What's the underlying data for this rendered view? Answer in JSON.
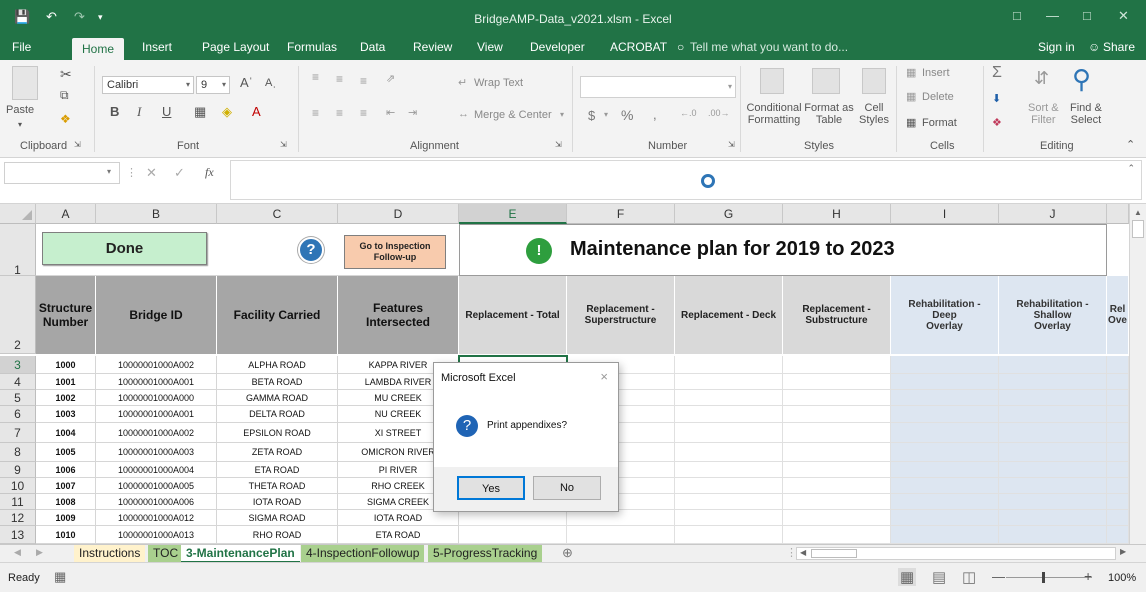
{
  "window": {
    "title": "BridgeAMP-Data_v2021.xlsm - Excel"
  },
  "tabs": [
    {
      "label": "File"
    },
    {
      "label": "Home"
    },
    {
      "label": "Insert"
    },
    {
      "label": "Page Layout"
    },
    {
      "label": "Formulas"
    },
    {
      "label": "Data"
    },
    {
      "label": "Review"
    },
    {
      "label": "View"
    },
    {
      "label": "Developer"
    },
    {
      "label": "ACROBAT"
    }
  ],
  "tell_me": "Tell me what you want to do...",
  "sign_in": "Sign in",
  "share": "Share",
  "ribbon": {
    "paste": "Paste",
    "font_name": "Calibri",
    "font_size": "9",
    "wrap_text": "Wrap Text",
    "merge_center": "Merge & Center",
    "number_format": "",
    "conditional": [
      "Conditional",
      "Formatting"
    ],
    "format_as": [
      "Format as",
      "Table"
    ],
    "cell_styles": [
      "Cell",
      "Styles"
    ],
    "insert": "Insert",
    "delete": "Delete",
    "format": "Format",
    "sort_filter": [
      "Sort &",
      "Filter"
    ],
    "find_select": [
      "Find &",
      "Select"
    ],
    "groups": {
      "clipboard": "Clipboard",
      "font": "Font",
      "alignment": "Alignment",
      "number": "Number",
      "styles": "Styles",
      "cells": "Cells",
      "editing": "Editing"
    }
  },
  "formula_bar": {
    "name_box": "",
    "fx": "fx",
    "content": ""
  },
  "columns": [
    "A",
    "B",
    "C",
    "D",
    "E",
    "F",
    "G",
    "H",
    "I",
    "J"
  ],
  "row_numbers": [
    "1",
    "2",
    "3",
    "4",
    "5",
    "6",
    "7",
    "8",
    "9",
    "10",
    "11",
    "12",
    "13"
  ],
  "buttons": {
    "done": "Done",
    "help": "?",
    "goto": [
      "Go to Inspection",
      "Follow-up"
    ]
  },
  "heading": {
    "icon": "!",
    "text": "Maintenance plan for 2019 to 2023"
  },
  "headers": {
    "a": [
      "Structure",
      "Number"
    ],
    "b": "Bridge ID",
    "c": "Facility Carried",
    "d": "Features Intersected",
    "e": "Replacement - Total",
    "f": [
      "Replacement -",
      "Superstructure"
    ],
    "g": "Replacement - Deck",
    "h": [
      "Replacement -",
      "Substructure"
    ],
    "i": [
      "Rehabilitation - Deep",
      "Overlay"
    ],
    "j": [
      "Rehabilitation - Shallow",
      "Overlay"
    ],
    "k": [
      "Rel",
      "Ove"
    ]
  },
  "rows": [
    {
      "a": "1000",
      "b": "10000001000A002",
      "c": "ALPHA ROAD",
      "d": "KAPPA RIVER"
    },
    {
      "a": "1001",
      "b": "10000001000A001",
      "c": "BETA ROAD",
      "d": "LAMBDA RIVER"
    },
    {
      "a": "1002",
      "b": "10000001000A000",
      "c": "GAMMA ROAD",
      "d": "MU CREEK"
    },
    {
      "a": "1003",
      "b": "10000001000A001",
      "c": "DELTA ROAD",
      "d": "NU CREEK"
    },
    {
      "a": "1004",
      "b": "10000001000A002",
      "c": "EPSILON ROAD",
      "d": "XI STREET"
    },
    {
      "a": "1005",
      "b": "10000001000A003",
      "c": "ZETA ROAD",
      "d": "OMICRON RIVER"
    },
    {
      "a": "1006",
      "b": "10000001000A004",
      "c": "ETA ROAD",
      "d": "PI RIVER"
    },
    {
      "a": "1007",
      "b": "10000001000A005",
      "c": "THETA ROAD",
      "d": "RHO CREEK"
    },
    {
      "a": "1008",
      "b": "10000001000A006",
      "c": "IOTA ROAD",
      "d": "SIGMA CREEK"
    },
    {
      "a": "1009",
      "b": "10000001000A012",
      "c": "SIGMA ROAD",
      "d": "IOTA ROAD"
    },
    {
      "a": "1010",
      "b": "10000001000A013",
      "c": "RHO ROAD",
      "d": "ETA ROAD"
    }
  ],
  "dialog": {
    "title": "Microsoft Excel",
    "message": "Print appendixes?",
    "yes": "Yes",
    "no": "No",
    "close": "×"
  },
  "sheets": [
    "Instructions",
    "TOC",
    "3-MaintenancePlan",
    "4-InspectionFollowup",
    "5-ProgressTracking"
  ],
  "status": {
    "ready": "Ready",
    "zoom": "100%"
  },
  "colors": {
    "excel_green": "#217346",
    "done_bg": "#c6efce",
    "goto_bg": "#f8cbad",
    "header_gray": "#a6a6a6",
    "blue_fill": "#dde6f1",
    "help_blue": "#2e75b6",
    "bang_green": "#2e9e3e"
  }
}
